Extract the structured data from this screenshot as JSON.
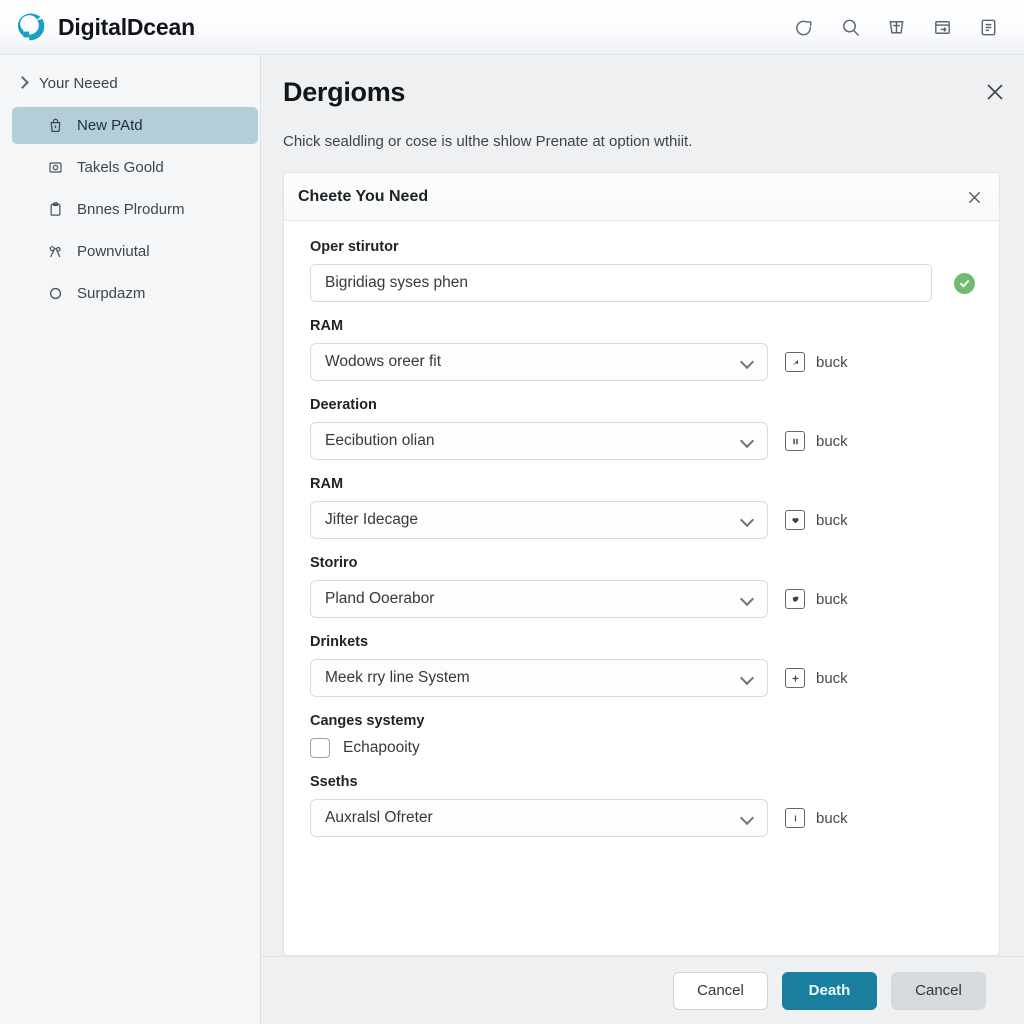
{
  "topbar": {
    "brand_name": "DigitalDcean",
    "logo_icon": "droplet-logo-icon",
    "brand_color": "#1a9ec4",
    "icons": [
      {
        "name": "logout-icon",
        "label": ""
      },
      {
        "name": "search-icon",
        "label": ""
      },
      {
        "name": "cart-icon",
        "label": ""
      },
      {
        "name": "document-share-icon",
        "label": ""
      },
      {
        "name": "card-list-icon",
        "label": ""
      }
    ]
  },
  "sidebar": {
    "header": {
      "label": "Your Neeed",
      "icon": "chevron-right-icon"
    },
    "items": [
      {
        "label": "New PAtd",
        "icon": "bag-icon",
        "selected": true
      },
      {
        "label": "Takels Goold",
        "icon": "image-icon",
        "selected": false
      },
      {
        "label": "Bnnes Plrodurm",
        "icon": "clipboard-icon",
        "selected": false
      },
      {
        "label": "Pownviutal",
        "icon": "network-icon",
        "selected": false
      },
      {
        "label": "Surpdazm",
        "icon": "circle-icon",
        "selected": false
      }
    ],
    "selected_color": "#b4ced7"
  },
  "panel": {
    "title": "Dergioms",
    "subtitle": "Chick sealdling or cose is ulthe shlow Prenate at option wthiit.",
    "close_icon": "close-icon"
  },
  "card": {
    "title": "Cheete You Need",
    "close_icon": "close-icon",
    "text_field": {
      "label": "Oper stirutor",
      "value": "Bigridiag syses phen",
      "placeholder": "Bigridiag syses phen",
      "valid_icon": "check-circle-icon",
      "valid_color": "#6fbb6f"
    },
    "rows": [
      {
        "label": "RAM",
        "value": "Wodows oreer fit",
        "note": "buck",
        "note_icon": "pointer-square-icon"
      },
      {
        "label": "Deeration",
        "value": "Eecibution olian",
        "note": "buck",
        "note_icon": "pause-square-icon"
      },
      {
        "label": "RAM",
        "value": "Jifter Idecage",
        "note": "buck",
        "note_icon": "heart-square-icon"
      },
      {
        "label": "Storiro",
        "value": "Pland Ooerabor",
        "note": "buck",
        "note_icon": "leaf-square-icon"
      },
      {
        "label": "Drinkets",
        "value": "Meek rry line System",
        "note": "buck",
        "note_icon": "plus-square-icon"
      }
    ],
    "checkbox_group": {
      "label": "Canges systemy",
      "option_label": "Echapooity",
      "checked": false
    },
    "last_row": {
      "label": "Sseths",
      "value": "Auxralsl Ofreter",
      "note": "buck",
      "note_icon": "info-square-icon"
    }
  },
  "footer": {
    "cancel_label": "Cancel",
    "primary_label": "Death",
    "secondary_label": "Cancel",
    "primary_color": "#1a7e9e"
  }
}
